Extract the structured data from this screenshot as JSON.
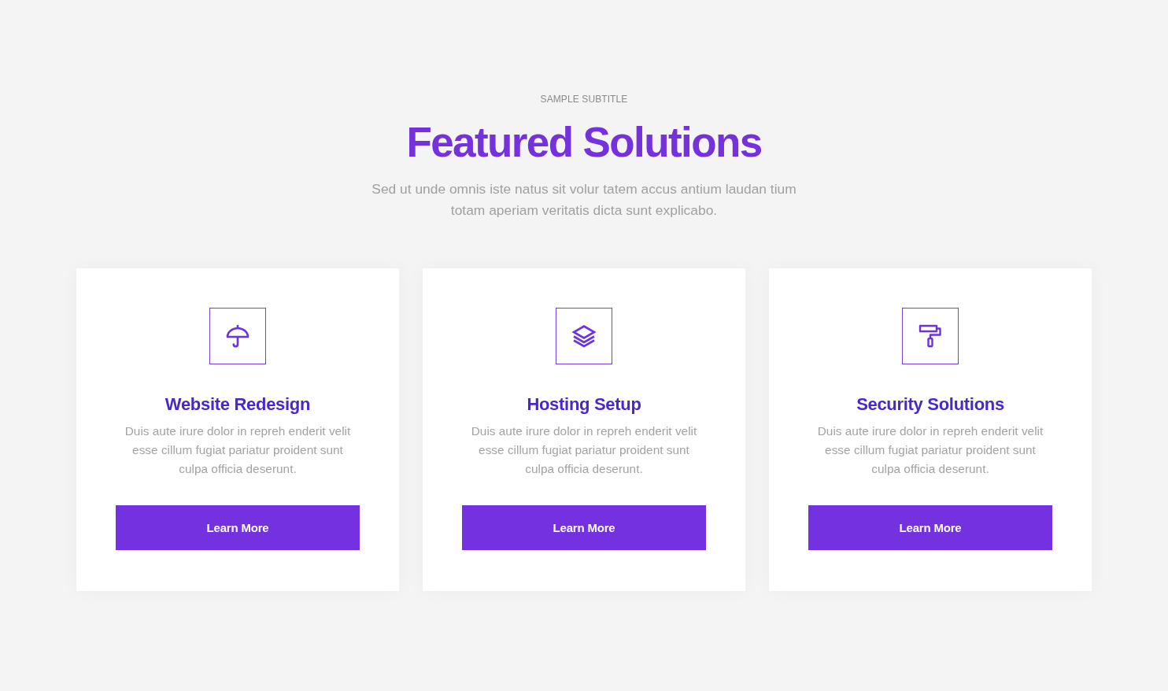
{
  "header": {
    "subtitle": "SAMPLE SUBTITLE",
    "title": "Featured Solutions",
    "description": "Sed ut unde omnis iste natus sit volur tatem accus antium laudan tium totam aperiam veritatis dicta sunt explicabo."
  },
  "cards": [
    {
      "title": "Website Redesign",
      "text": "Duis aute irure dolor in repreh enderit velit esse cillum fugiat pariatur proident sunt culpa officia deserunt.",
      "button": "Learn More"
    },
    {
      "title": "Hosting Setup",
      "text": "Duis aute irure dolor in repreh enderit velit esse cillum fugiat pariatur proident sunt culpa officia deserunt.",
      "button": "Learn More"
    },
    {
      "title": "Security Solutions",
      "text": "Duis aute irure dolor in repreh enderit velit esse cillum fugiat pariatur proident sunt culpa officia deserunt.",
      "button": "Learn More"
    }
  ]
}
